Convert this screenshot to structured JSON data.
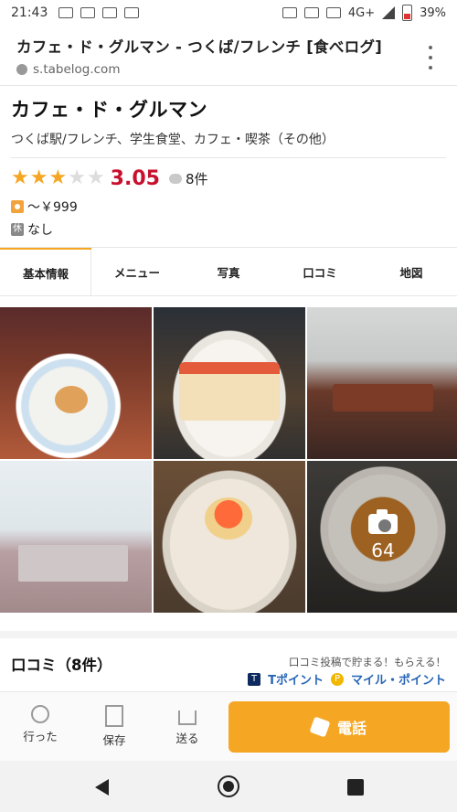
{
  "statusbar": {
    "time": "21:43",
    "network": "4G+",
    "battery": "39%"
  },
  "browser": {
    "page_title": "カフェ・ド・グルマン - つくば/フレンチ [食べログ]",
    "domain": "s.tabelog.com"
  },
  "restaurant": {
    "name": "カフェ・ド・グルマン",
    "genre": "つくば駅/フレンチ、学生食堂、カフェ・喫茶（その他）",
    "rating": {
      "stars": "★★★★★",
      "stars_filled": 3.05,
      "score": "3.05",
      "review_count": "8件"
    },
    "price": "～￥999",
    "holiday_badge": "休",
    "holiday": "なし"
  },
  "tabs": [
    {
      "label": "基本情報",
      "active": true
    },
    {
      "label": "メニュー",
      "active": false
    },
    {
      "label": "写真",
      "active": false
    },
    {
      "label": "口コミ",
      "active": false
    },
    {
      "label": "地図",
      "active": false
    }
  ],
  "photos": {
    "more_count": "64"
  },
  "reviews": {
    "title": "口コミ（8件）",
    "promo": "口コミ投稿で貯まる！もらえる！",
    "tpoint_badge": "T",
    "tpoint_label": "Tポイント",
    "mile_badge": "P",
    "mile_label": "マイル・ポイント"
  },
  "actions": {
    "went": "行った",
    "save": "保存",
    "send": "送る",
    "call": "電話"
  },
  "colors": {
    "accent": "#f5a623",
    "score": "#c8102e",
    "link": "#2665b5"
  },
  "icons": [
    "line-icon",
    "mail-icon",
    "mail-icon",
    "wifi-call-icon",
    "nfc-icon",
    "mute-icon",
    "volte-icon",
    "signal-icon",
    "battery-icon",
    "lock-icon",
    "kebab-menu-icon",
    "comment-icon",
    "price-icon",
    "holiday-icon",
    "camera-icon",
    "check-icon",
    "bookmark-icon",
    "share-icon",
    "phone-icon",
    "back-icon",
    "home-icon",
    "recents-icon"
  ]
}
